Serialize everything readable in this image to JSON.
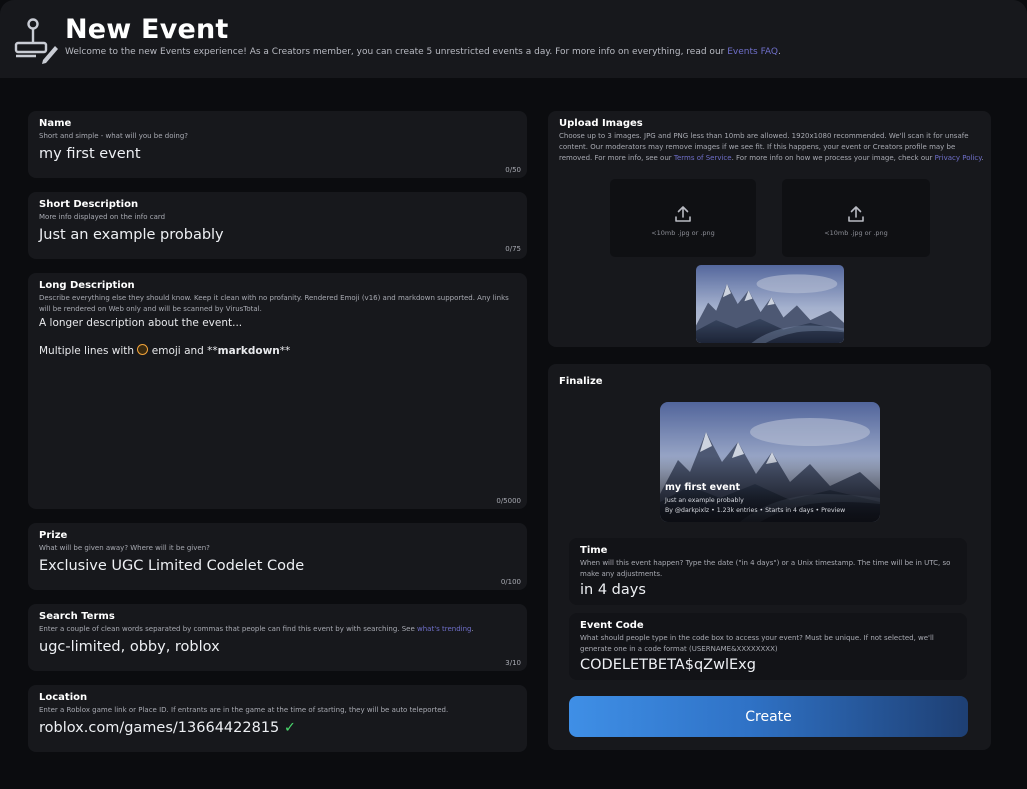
{
  "header": {
    "title": "New Event",
    "subtitle": "Welcome to the new Events experience! As a Creators member, you can create 5 unrestricted events a day. For more info on everything, read our",
    "faq_link": "Events FAQ",
    "subtitle_end": "."
  },
  "fields": {
    "name": {
      "label": "Name",
      "help": "Short and simple - what will you be doing?",
      "value": "my first event",
      "count": "0/50"
    },
    "short_description": {
      "label": "Short Description",
      "help": "More info displayed on the info card",
      "value": "Just an example probably",
      "count": "0/75"
    },
    "long_description": {
      "label": "Long Description",
      "help": "Describe everything else they should know. Keep it clean with no profanity. Rendered Emoji (v16) and markdown supported. Any links will be rendered on Web only and will be scanned by VirusTotal.",
      "line1": "A longer description about the event...",
      "line2_a": "Multiple lines with",
      "line2_b": "emoji and **",
      "line2_bold": "markdown",
      "line2_c": "**",
      "count": "0/5000"
    },
    "prize": {
      "label": "Prize",
      "help": "What will be given away? Where will it be given?",
      "value": "Exclusive UGC Limited Codelet Code",
      "count": "0/100"
    },
    "search_terms": {
      "label": "Search Terms",
      "help": "Enter a couple of clean words separated by commas that people can find this event by with searching. See",
      "help_link": "what's trending",
      "help_end": ".",
      "value": "ugc-limited, obby, roblox",
      "count": "3/10"
    },
    "location": {
      "label": "Location",
      "help": "Enter a Roblox game link or Place ID. If entrants are in the game at the time of starting, they will be auto teleported.",
      "value": "roblox.com/games/13664422815",
      "check": "✓"
    }
  },
  "upload": {
    "label": "Upload Images",
    "help_a": "Choose up to 3 images. JPG and PNG less than 10mb are allowed. 1920x1080 recommended. We'll scan it for unsafe content. Our moderators may remove images if we see fit. If this happens, your event or Creators profile may be removed. For more info, see our",
    "tos_link": "Terms of Service",
    "help_b": ". For more info on how we process your image, check our",
    "privacy_link": "Privacy Policy",
    "help_c": ".",
    "box_text": "<10mb .jpg or .png",
    "icon": "upload-icon"
  },
  "finalize": {
    "label": "Finalize",
    "preview_title": "my first event",
    "preview_sub": "Just an example probably",
    "preview_meta": "By @darkpixlz • 1.23k entries • Starts in 4 days • Preview",
    "time": {
      "label": "Time",
      "help": "When will this event happen? Type the date (\"in 4 days\") or a Unix timestamp. The time will be in UTC, so make any adjustments.",
      "value": "in 4 days"
    },
    "code": {
      "label": "Event Code",
      "help": "What should people type in the code box to access your event? Must be unique. If not selected, we'll generate one in a code format (USERNAME&XXXXXXXX)",
      "value": "CODELETBETA$qZwlExg"
    },
    "create_label": "Create"
  },
  "colors": {
    "background": "#0b0c0f",
    "card": "#17181c",
    "link": "#6f6fc9",
    "check": "#49d46b",
    "button_start": "#3f8fe6",
    "button_end": "#1e3f73"
  }
}
